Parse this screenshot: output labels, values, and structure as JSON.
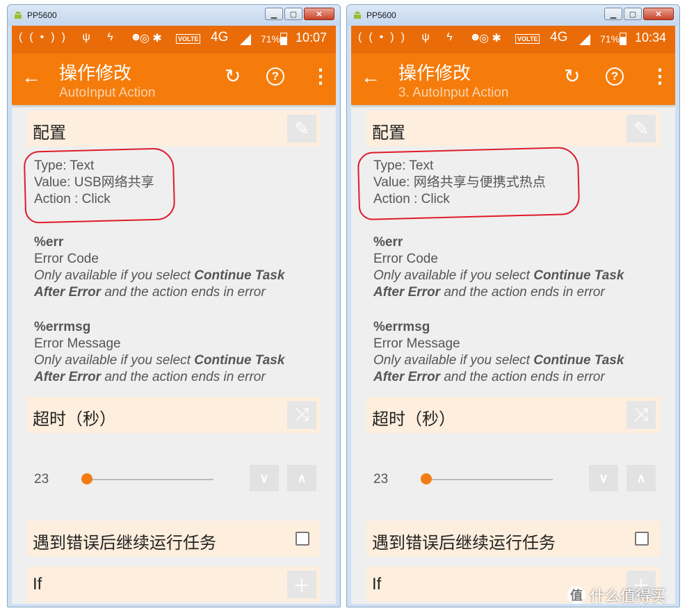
{
  "panels": [
    {
      "window_title": "PP5600",
      "status": {
        "left_icons": "((•)) ψ ϟ ☻",
        "mid_icons": "◎ ✱",
        "volte": "VOLTE",
        "network": "4G",
        "battery": "71%",
        "time": "10:07"
      },
      "appbar": {
        "title": "操作修改",
        "subtitle": "AutoInput Action"
      },
      "config": {
        "header": "配置",
        "type_line": "Type: Text",
        "value_line": "Value: USB网络共享",
        "action_line": "Action : Click"
      },
      "err": {
        "name": "%err",
        "desc": "Error Code",
        "note1_pre": "Only available if you select ",
        "note1_bold": "Continue Task",
        "note2_bold": "After Error",
        "note2_post": " and the action ends in error"
      },
      "errmsg": {
        "name": "%errmsg",
        "desc": "Error Message",
        "note1_pre": "Only available if you select ",
        "note1_bold": "Continue Task",
        "note2_bold": "After Error",
        "note2_post": " and the action ends in error"
      },
      "timeout": {
        "header": "超时（秒）",
        "value": "23",
        "slider_fraction": 0.0
      },
      "continue_on_error": {
        "label": "遇到错误后继续运行任务",
        "checked": false
      },
      "if_section": {
        "label": "If"
      }
    },
    {
      "window_title": "PP5600",
      "status": {
        "left_icons": "((•)) ψ ϟ ☻",
        "mid_icons": "◎ ✱",
        "volte": "VOLTE",
        "network": "4G",
        "battery": "71%",
        "time": "10:34"
      },
      "appbar": {
        "title": "操作修改",
        "subtitle": "3. AutoInput Action"
      },
      "config": {
        "header": "配置",
        "type_line": "Type: Text",
        "value_line": "Value: 网络共享与便携式热点",
        "action_line": "Action : Click"
      },
      "err": {
        "name": "%err",
        "desc": "Error Code",
        "note1_pre": "Only available if you select ",
        "note1_bold": "Continue Task",
        "note2_bold": "After Error",
        "note2_post": " and the action ends in error"
      },
      "errmsg": {
        "name": "%errmsg",
        "desc": "Error Message",
        "note1_pre": "Only available if you select ",
        "note1_bold": "Continue Task",
        "note2_bold": "After Error",
        "note2_post": " and the action ends in error"
      },
      "timeout": {
        "header": "超时（秒）",
        "value": "23",
        "slider_fraction": 0.0
      },
      "continue_on_error": {
        "label": "遇到错误后继续运行任务",
        "checked": false
      },
      "if_section": {
        "label": "If"
      }
    }
  ],
  "icons": {
    "app": "android-icon",
    "back": "arrow-left-icon",
    "undo": "undo-icon",
    "help": "help-circle-icon",
    "more": "more-vert-icon",
    "edit": "pencil-icon",
    "shuffle": "shuffle-icon",
    "down": "chevron-down-icon",
    "up": "chevron-up-icon",
    "add": "plus-icon"
  },
  "colors": {
    "status_bar": "#e96c09",
    "app_bar": "#f57c0b",
    "section_header": "#fdeedd",
    "annotation_circle": "#e01a28"
  },
  "watermark": {
    "text": "什么值得买",
    "logo": "值"
  }
}
